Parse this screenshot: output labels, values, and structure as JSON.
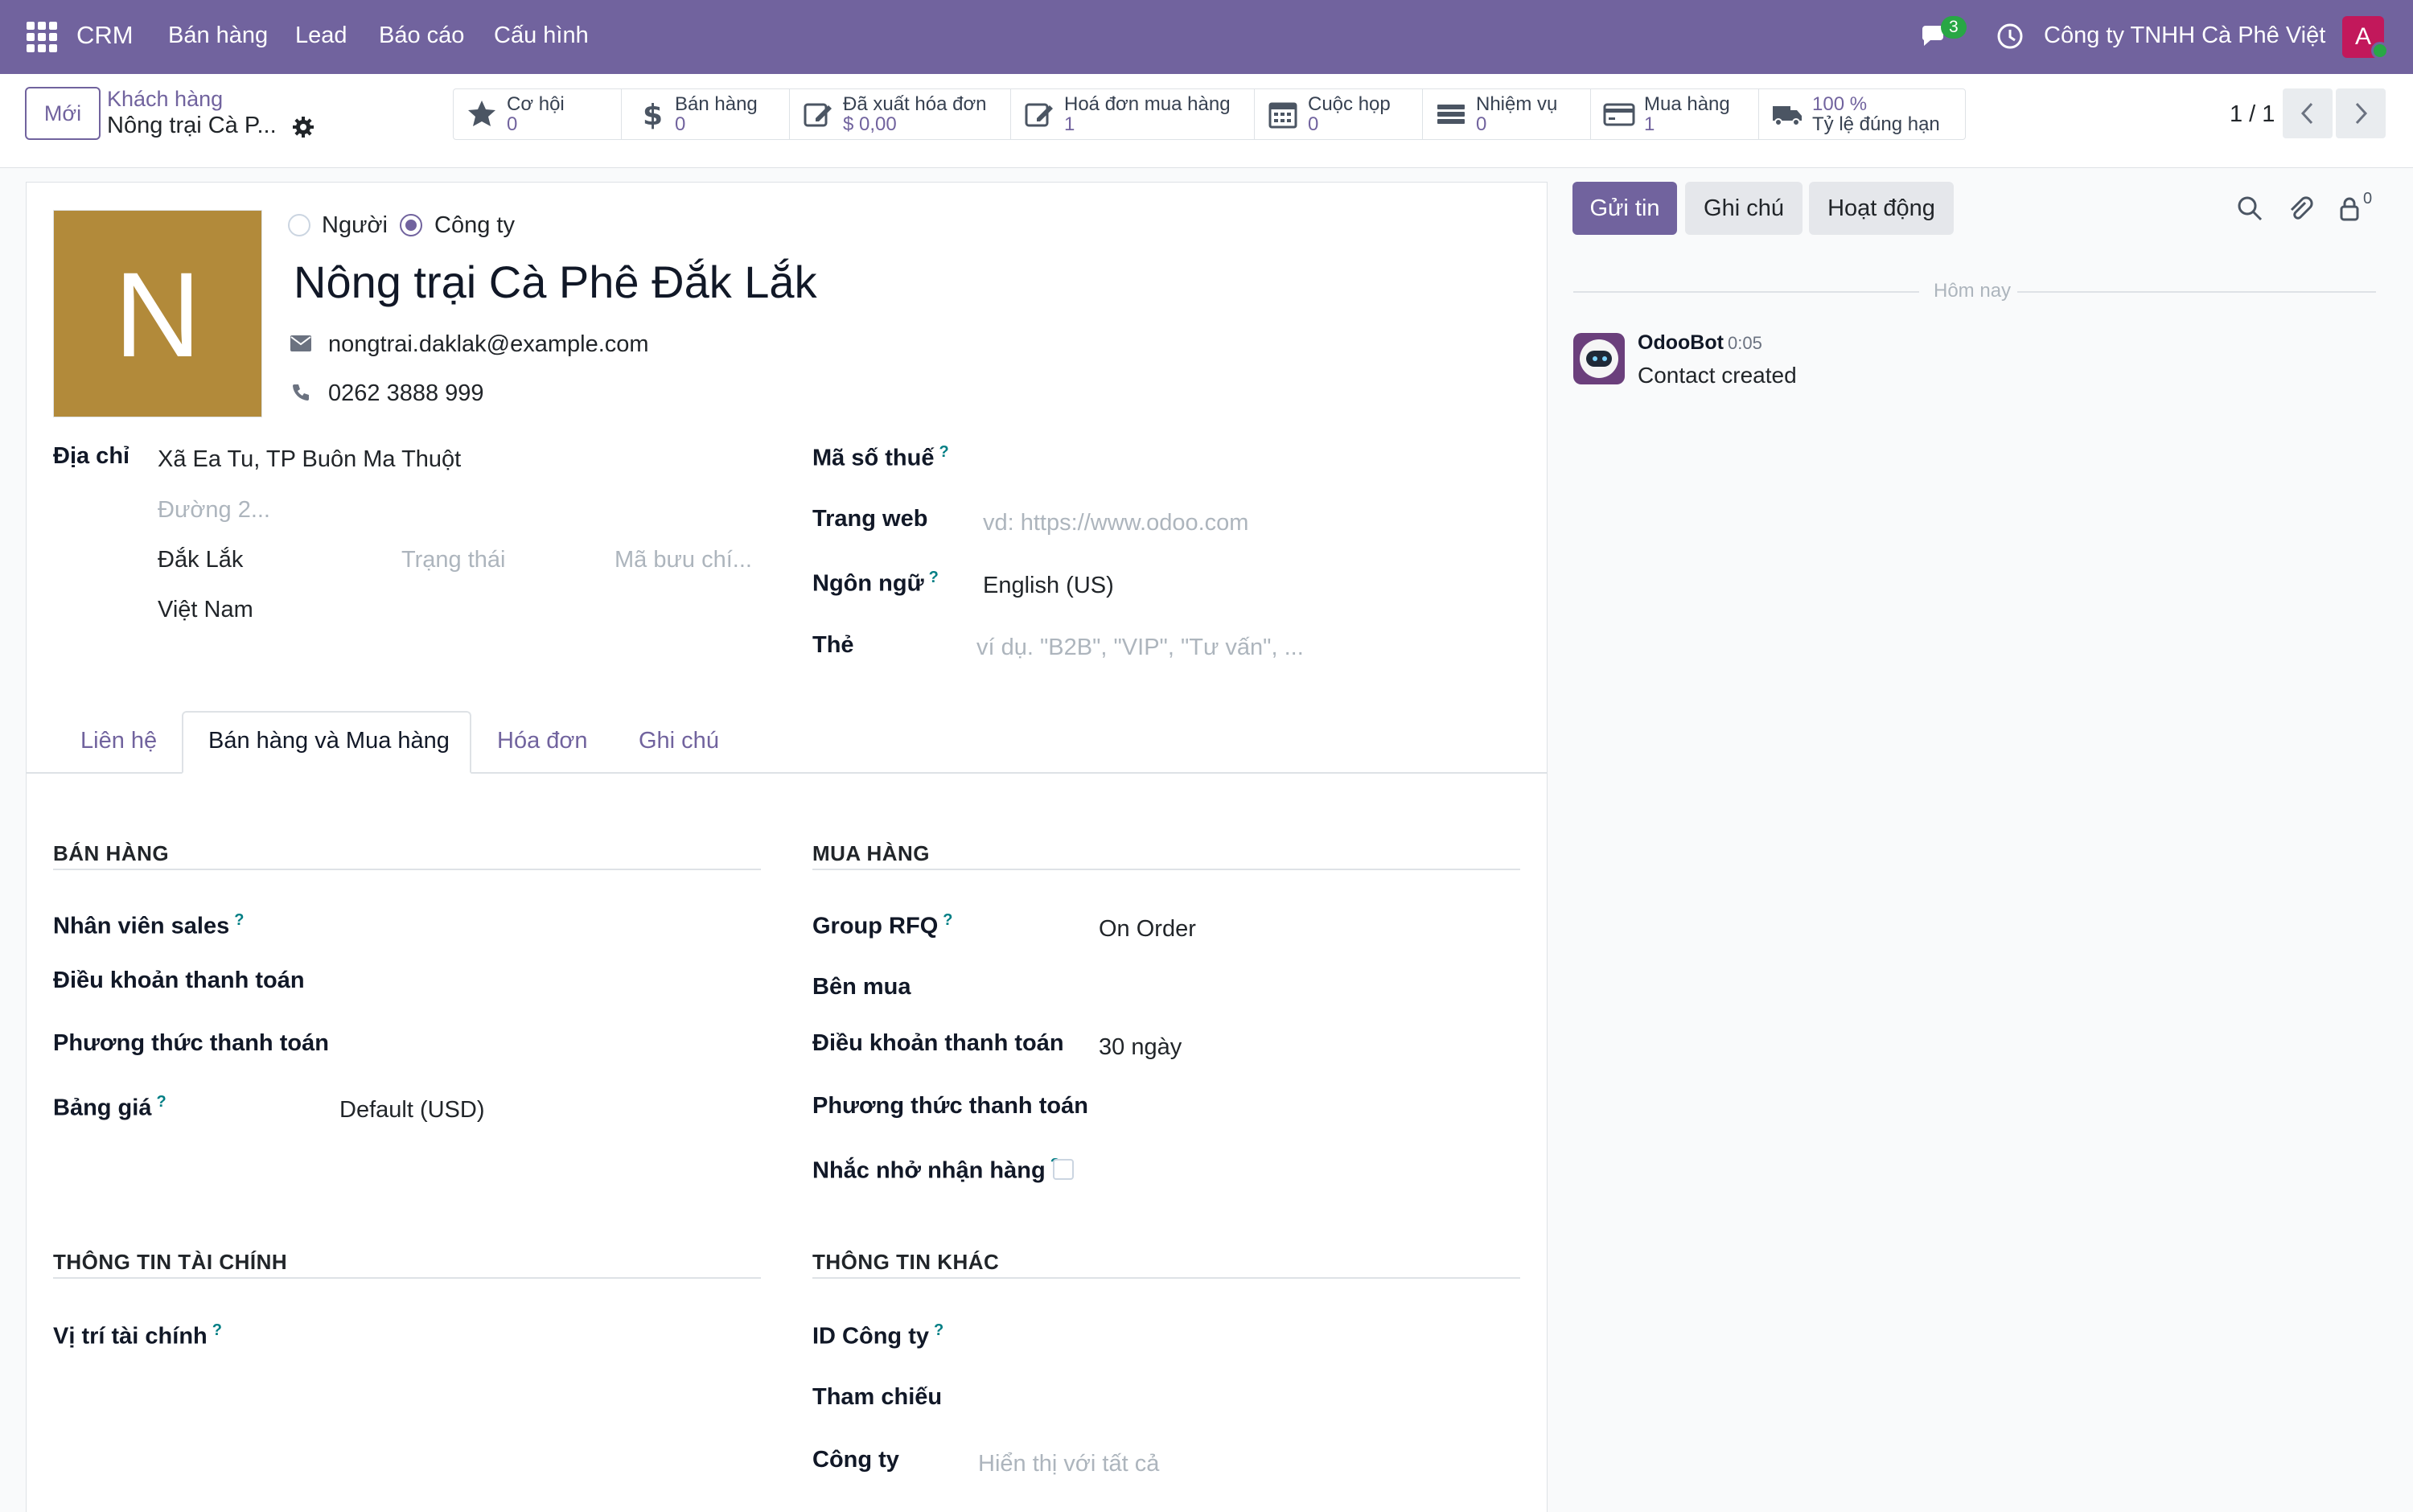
{
  "topnav": {
    "brand": "CRM",
    "menu": [
      "Bán hàng",
      "Lead",
      "Báo cáo",
      "Cấu hình"
    ],
    "messages_count": "3",
    "company": "Công ty TNHH Cà Phê Việt",
    "avatar_letter": "A",
    "bg_color": "#71639e"
  },
  "control": {
    "new_label": "Mới",
    "breadcrumb_parent": "Khách hàng",
    "breadcrumb_current": "Nông trại Cà P...",
    "stats": [
      {
        "label": "Cơ hội",
        "value": "0",
        "icon": "star-icon"
      },
      {
        "label": "Bán hàng",
        "value": "0",
        "icon": "dollar-icon"
      },
      {
        "label": "Đã xuất hóa đơn",
        "value": "$ 0,00",
        "icon": "edit-icon"
      },
      {
        "label": "Hoá đơn mua hàng",
        "value": "1",
        "icon": "edit-icon"
      },
      {
        "label": "Cuộc họp",
        "value": "0",
        "icon": "calendar-icon"
      },
      {
        "label": "Nhiệm vụ",
        "value": "0",
        "icon": "tasks-icon"
      },
      {
        "label": "Mua hàng",
        "value": "1",
        "icon": "credit-card-icon"
      },
      {
        "label": "Tỷ lệ đúng hạn",
        "value": "100  %",
        "icon": "truck-icon"
      }
    ],
    "pager": "1 / 1"
  },
  "form": {
    "avatar_letter": "N",
    "type_person": "Người",
    "type_company": "Công ty",
    "name": "Nông trại Cà Phê Đắk Lắk",
    "email": "nongtrai.daklak@example.com",
    "phone": "0262 3888 999",
    "address_label": "Địa chỉ",
    "street": "Xã Ea Tu, TP Buôn Ma Thuột",
    "street2_placeholder": "Đường 2...",
    "city": "Đắk Lắk",
    "state_placeholder": "Trạng thái",
    "zip_placeholder": "Mã bưu chí...",
    "country": "Việt Nam",
    "vat_label": "Mã số thuế",
    "website_label": "Trang web",
    "website_placeholder": "vd: https://www.odoo.com",
    "language_label": "Ngôn ngữ",
    "language": "English (US)",
    "tags_label": "Thẻ",
    "tags_placeholder": "ví dụ. \"B2B\", \"VIP\", \"Tư vấn\", ..."
  },
  "tabs": [
    "Liên hệ",
    "Bán hàng và Mua hàng",
    "Hóa đơn",
    "Ghi chú"
  ],
  "sales": {
    "title": "BÁN HÀNG",
    "salesperson_label": "Nhân viên sales",
    "payment_terms_label": "Điều khoản thanh toán",
    "payment_method_label": "Phương thức thanh toán",
    "pricelist_label": "Bảng giá",
    "pricelist": "Default (USD)"
  },
  "purchase": {
    "title": "MUA HÀNG",
    "group_rfq_label": "Group RFQ",
    "group_rfq": "On Order",
    "buyer_label": "Bên mua",
    "payment_terms_label": "Điều khoản thanh toán",
    "payment_terms": "30 ngày",
    "payment_method_label": "Phương thức thanh toán",
    "receipt_reminder_label": "Nhắc nhở nhận hàng"
  },
  "fiscal": {
    "title": "THÔNG TIN TÀI CHÍNH",
    "position_label": "Vị trí tài chính"
  },
  "misc": {
    "title": "THÔNG TIN KHÁC",
    "company_id_label": "ID Công ty",
    "reference_label": "Tham chiếu",
    "company_label": "Công ty",
    "company_placeholder": "Hiển thị với tất cả"
  },
  "chatter": {
    "send_message": "Gửi tin",
    "log_note": "Ghi chú",
    "activities": "Hoạt động",
    "followers_count": "0",
    "today": "Hôm nay",
    "author": "OdooBot",
    "time": "0:05",
    "message": "Contact created"
  }
}
